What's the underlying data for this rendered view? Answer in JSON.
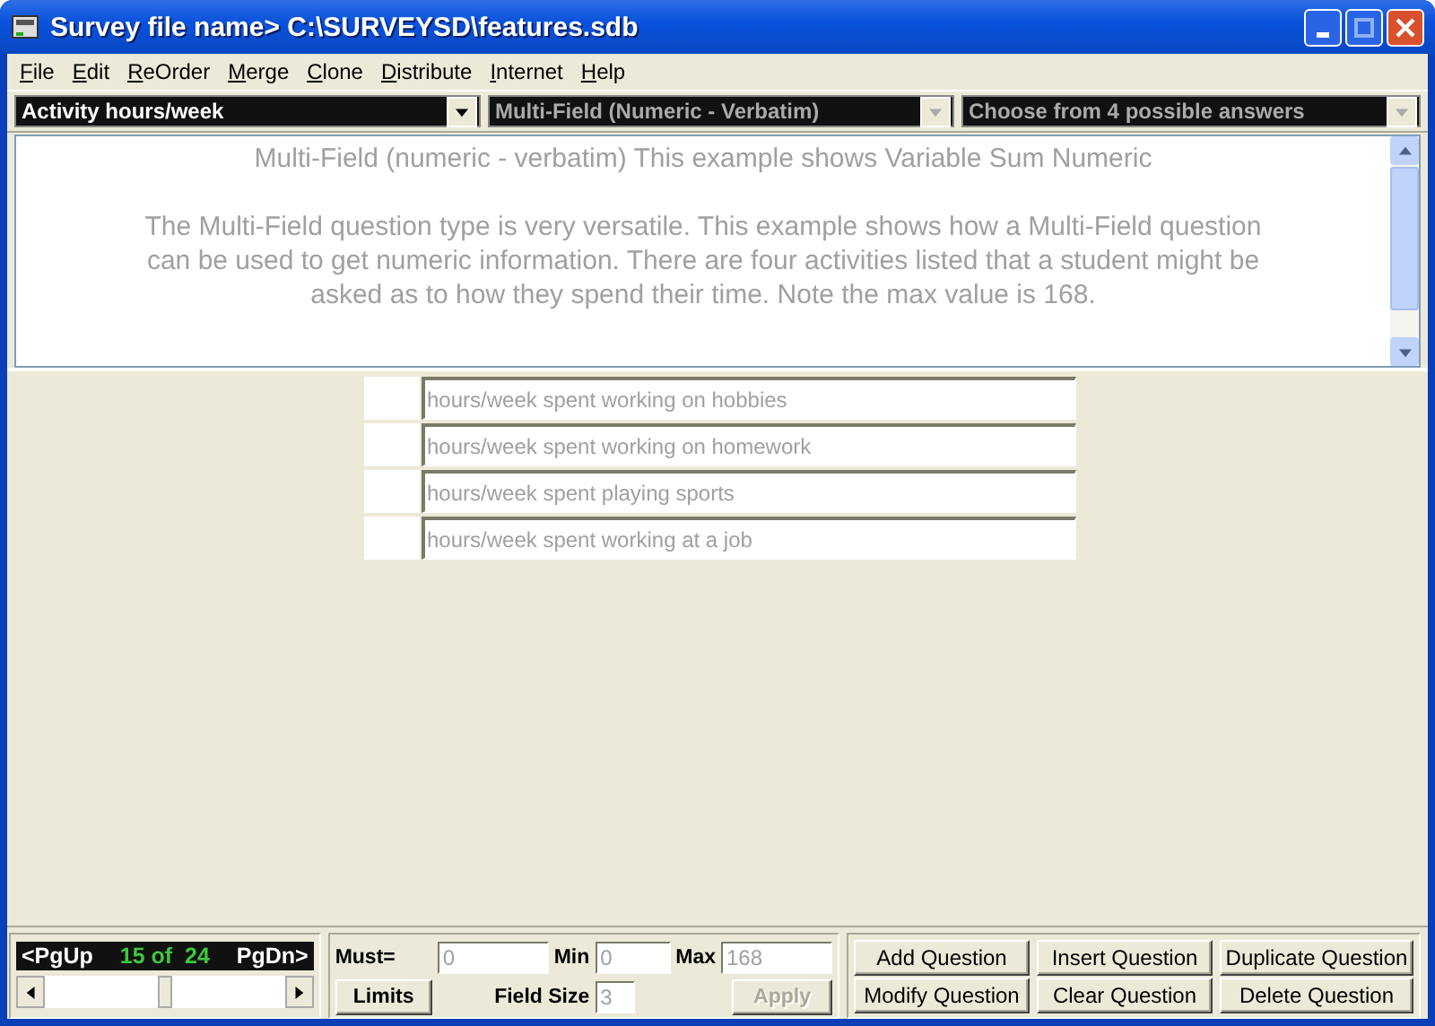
{
  "window": {
    "title": "Survey file name> C:\\SURVEYSD\\features.sdb"
  },
  "menu": [
    "File",
    "Edit",
    "ReOrder",
    "Merge",
    "Clone",
    "Distribute",
    "Internet",
    "Help"
  ],
  "selectors": [
    {
      "value": "Activity hours/week",
      "disabled": false
    },
    {
      "value": "Multi-Field (Numeric - Verbatim)",
      "disabled": true
    },
    {
      "value": "Choose from 4 possible answers",
      "disabled": true
    }
  ],
  "question": {
    "title": "Multi-Field (numeric - verbatim) This example shows Variable Sum Numeric",
    "body": "The Multi-Field question type is very versatile. This example shows how a Multi-Field question can be used to get numeric information. There are four activities listed that a student might be asked as to how they spend their time. Note the max value is 168."
  },
  "fields": [
    {
      "placeholder": "hours/week spent working on hobbies"
    },
    {
      "placeholder": "hours/week spent working on homework"
    },
    {
      "placeholder": "hours/week spent playing sports"
    },
    {
      "placeholder": "hours/week spent working at a job"
    }
  ],
  "navigator": {
    "prev": "<PgUp",
    "position": "15 of",
    "total": "24",
    "next": "PgDn>"
  },
  "limits": {
    "must_label": "Must=",
    "must_value": "0",
    "min_label": "Min",
    "min_value": "0",
    "max_label": "Max",
    "max_value": "168",
    "limits_button": "Limits",
    "field_size_label": "Field Size",
    "field_size_value": "3",
    "apply": {
      "label": "Apply",
      "disabled": true
    }
  },
  "buttons": [
    "Add Question",
    "Insert Question",
    "Duplicate Question",
    "Modify Question",
    "Clear Question",
    "Delete Question"
  ]
}
